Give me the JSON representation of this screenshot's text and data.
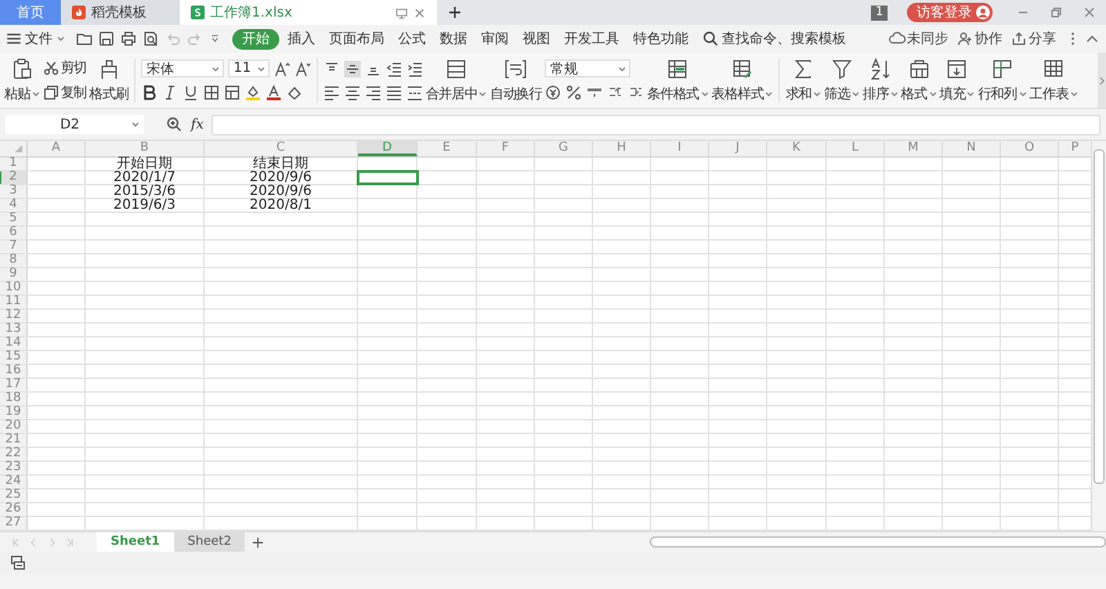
{
  "browser_tabs": [
    {
      "label": "首页",
      "kind": "home",
      "selected": false
    },
    {
      "label": "稻壳模板",
      "kind": "template",
      "selected": false
    },
    {
      "label": "工作簿1.xlsx",
      "kind": "workbook",
      "selected": true
    }
  ],
  "title_bar": {
    "window_count": "1",
    "login": "访客登录"
  },
  "menu": {
    "file": "文件",
    "tabs": [
      {
        "label": "开始",
        "selected": true
      },
      {
        "label": "插入",
        "selected": false
      },
      {
        "label": "页面布局",
        "selected": false
      },
      {
        "label": "公式",
        "selected": false
      },
      {
        "label": "数据",
        "selected": false
      },
      {
        "label": "审阅",
        "selected": false
      },
      {
        "label": "视图",
        "selected": false
      },
      {
        "label": "开发工具",
        "selected": false
      },
      {
        "label": "特色功能",
        "selected": false
      }
    ],
    "search": "查找命令、搜索模板",
    "sync": "未同步",
    "collaborate": "协作",
    "share": "分享"
  },
  "ribbon": {
    "paste": "粘贴",
    "cut": "剪切",
    "copy": "复制",
    "format_painter": "格式刷",
    "font_name": "宋体",
    "font_size": "11",
    "vertical_align": [
      {
        "selected": false
      },
      {
        "selected": true
      },
      {
        "selected": false
      }
    ],
    "merge_center": "合并居中",
    "wrap_text": "自动换行",
    "number_format": "常规",
    "conditional_format": "条件格式",
    "table_style": "表格样式",
    "sum": "求和",
    "filter": "筛选",
    "sort": "排序",
    "format": "格式",
    "fill": "填充",
    "rows_columns": "行和列",
    "worksheet": "工作表"
  },
  "formula_bar": {
    "cell_reference": "D2",
    "fx": "fx"
  },
  "columns": [
    {
      "label": "A",
      "selected": false
    },
    {
      "label": "B",
      "selected": false
    },
    {
      "label": "C",
      "selected": false
    },
    {
      "label": "D",
      "selected": true
    },
    {
      "label": "E",
      "selected": false
    },
    {
      "label": "F",
      "selected": false
    },
    {
      "label": "G",
      "selected": false
    },
    {
      "label": "H",
      "selected": false
    },
    {
      "label": "I",
      "selected": false
    },
    {
      "label": "J",
      "selected": false
    },
    {
      "label": "K",
      "selected": false
    },
    {
      "label": "L",
      "selected": false
    },
    {
      "label": "M",
      "selected": false
    },
    {
      "label": "N",
      "selected": false
    },
    {
      "label": "O",
      "selected": false
    },
    {
      "label": "P",
      "selected": false
    }
  ],
  "rows": [
    {
      "number": "1",
      "selected": false,
      "cells": [
        {
          "text": "开始日期"
        },
        {
          "text": "结束日期"
        }
      ]
    },
    {
      "number": "2",
      "selected": true,
      "cells": [
        {
          "text": "2020/1/7"
        },
        {
          "text": "2020/9/6"
        }
      ]
    },
    {
      "number": "3",
      "selected": false,
      "cells": [
        {
          "text": "2015/3/6"
        },
        {
          "text": "2020/9/6"
        }
      ]
    },
    {
      "number": "4",
      "selected": false,
      "cells": [
        {
          "text": "2019/6/3"
        },
        {
          "text": "2020/8/1"
        }
      ]
    },
    {
      "number": "5",
      "selected": false
    },
    {
      "number": "6",
      "selected": false
    },
    {
      "number": "7",
      "selected": false
    },
    {
      "number": "8",
      "selected": false
    },
    {
      "number": "9",
      "selected": false
    },
    {
      "number": "10",
      "selected": false
    },
    {
      "number": "11",
      "selected": false
    },
    {
      "number": "12",
      "selected": false
    },
    {
      "number": "13",
      "selected": false
    },
    {
      "number": "14",
      "selected": false
    },
    {
      "number": "15",
      "selected": false
    },
    {
      "number": "16",
      "selected": false
    },
    {
      "number": "17",
      "selected": false
    },
    {
      "number": "18",
      "selected": false
    },
    {
      "number": "19",
      "selected": false
    },
    {
      "number": "20",
      "selected": false
    },
    {
      "number": "21",
      "selected": false
    },
    {
      "number": "22",
      "selected": false
    },
    {
      "number": "23",
      "selected": false
    },
    {
      "number": "24",
      "selected": false
    },
    {
      "number": "25",
      "selected": false
    },
    {
      "number": "26",
      "selected": false
    },
    {
      "number": "27",
      "selected": false
    }
  ],
  "sheets": [
    {
      "label": "Sheet1",
      "selected": true
    },
    {
      "label": "Sheet2",
      "selected": false
    }
  ]
}
